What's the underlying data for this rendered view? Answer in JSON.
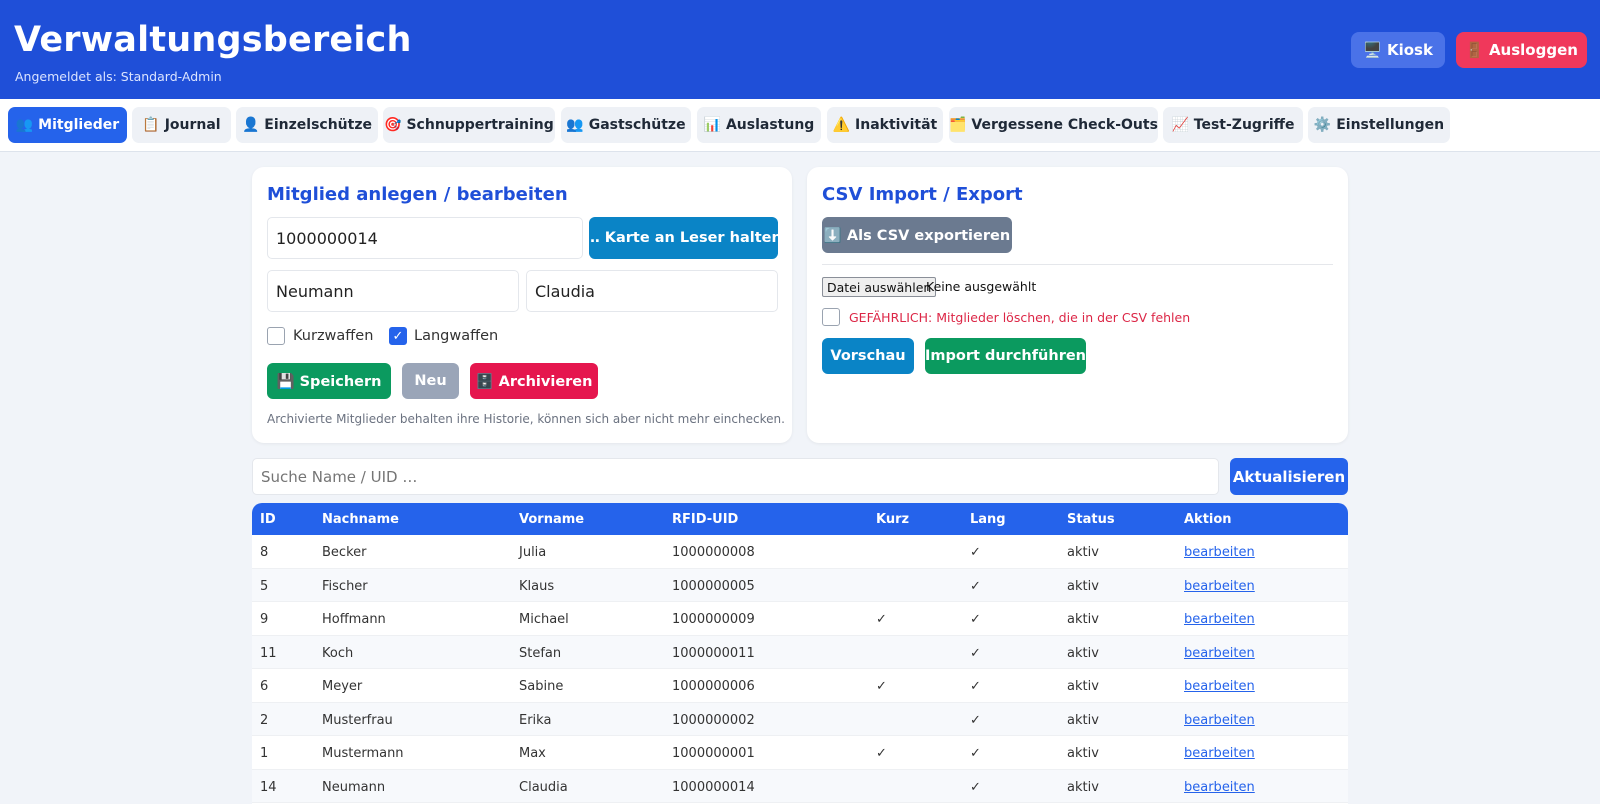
{
  "header": {
    "title": "Verwaltungsbereich",
    "subtitle": "Angemeldet als: Standard-Admin",
    "kiosk_label": "🖥️ Kiosk",
    "logout_label": "🚪 Ausloggen"
  },
  "tabs": [
    {
      "label": "👥 Mitglieder",
      "active": true
    },
    {
      "label": "📋 Journal"
    },
    {
      "label": "👤 Einzelschütze"
    },
    {
      "label": "🎯 Schnuppertraining"
    },
    {
      "label": "👥 Gastschütze"
    },
    {
      "label": "📊 Auslastung"
    },
    {
      "label": "⚠️ Inaktivität"
    },
    {
      "label": "🗂️ Vergessene Check-Outs"
    },
    {
      "label": "📈 Test-Zugriffe"
    },
    {
      "label": "⚙️ Einstellungen"
    }
  ],
  "member_form": {
    "title": "Mitglied anlegen / bearbeiten",
    "uid_value": "1000000014",
    "card_button": "… Karte an Leser halten",
    "lastname_value": "Neumann",
    "firstname_value": "Claudia",
    "kurzwaffen_label": "Kurzwaffen",
    "kurzwaffen_checked": false,
    "langwaffen_label": "Langwaffen",
    "langwaffen_checked": true,
    "checkmark": "✓",
    "save_label": "💾 Speichern",
    "new_label": "Neu",
    "archive_label": "🗄️ Archivieren",
    "hint": "Archivierte Mitglieder behalten ihre Historie, können sich aber nicht mehr einchecken."
  },
  "csv": {
    "title": "CSV Import / Export",
    "export_label": "⬇️ Als CSV exportieren",
    "file_button": "Datei auswählen",
    "file_status": "Keine ausgewählt",
    "danger_label": "GEFÄHRLICH: Mitglieder löschen, die in der CSV fehlen",
    "preview_label": "Vorschau",
    "import_label": "Import durchführen"
  },
  "search": {
    "placeholder": "Suche Name / UID …",
    "refresh_label": "Aktualisieren"
  },
  "table": {
    "columns": [
      "ID",
      "Nachname",
      "Vorname",
      "RFID-UID",
      "Kurz",
      "Lang",
      "Status",
      "Aktion"
    ],
    "rows": [
      {
        "id": "8",
        "last": "Becker",
        "first": "Julia",
        "uid": "1000000008",
        "kurz": "",
        "lang": "✓",
        "status": "aktiv",
        "action": "bearbeiten"
      },
      {
        "id": "5",
        "last": "Fischer",
        "first": "Klaus",
        "uid": "1000000005",
        "kurz": "",
        "lang": "✓",
        "status": "aktiv",
        "action": "bearbeiten"
      },
      {
        "id": "9",
        "last": "Hoffmann",
        "first": "Michael",
        "uid": "1000000009",
        "kurz": "✓",
        "lang": "✓",
        "status": "aktiv",
        "action": "bearbeiten"
      },
      {
        "id": "11",
        "last": "Koch",
        "first": "Stefan",
        "uid": "1000000011",
        "kurz": "",
        "lang": "✓",
        "status": "aktiv",
        "action": "bearbeiten"
      },
      {
        "id": "6",
        "last": "Meyer",
        "first": "Sabine",
        "uid": "1000000006",
        "kurz": "✓",
        "lang": "✓",
        "status": "aktiv",
        "action": "bearbeiten"
      },
      {
        "id": "2",
        "last": "Musterfrau",
        "first": "Erika",
        "uid": "1000000002",
        "kurz": "",
        "lang": "✓",
        "status": "aktiv",
        "action": "bearbeiten"
      },
      {
        "id": "1",
        "last": "Mustermann",
        "first": "Max",
        "uid": "1000000001",
        "kurz": "✓",
        "lang": "✓",
        "status": "aktiv",
        "action": "bearbeiten"
      },
      {
        "id": "14",
        "last": "Neumann",
        "first": "Claudia",
        "uid": "1000000014",
        "kurz": "",
        "lang": "✓",
        "status": "aktiv",
        "action": "bearbeiten"
      }
    ]
  }
}
